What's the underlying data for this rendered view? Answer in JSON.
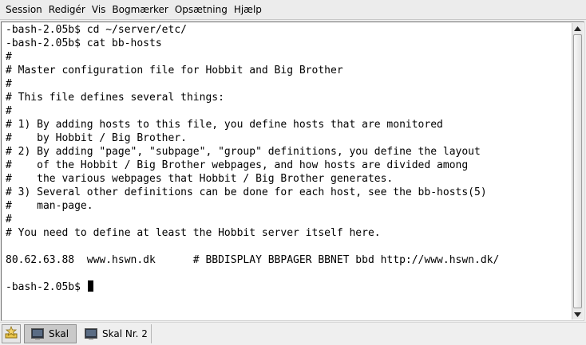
{
  "menubar": {
    "items": [
      "Session",
      "Redigér",
      "Vis",
      "Bogmærker",
      "Opsætning",
      "Hjælp"
    ]
  },
  "terminal": {
    "lines": [
      "-bash-2.05b$ cd ~/server/etc/",
      "-bash-2.05b$ cat bb-hosts",
      "#",
      "# Master configuration file for Hobbit and Big Brother",
      "#",
      "# This file defines several things:",
      "#",
      "# 1) By adding hosts to this file, you define hosts that are monitored",
      "#    by Hobbit / Big Brother.",
      "# 2) By adding \"page\", \"subpage\", \"group\" definitions, you define the layout",
      "#    of the Hobbit / Big Brother webpages, and how hosts are divided among",
      "#    the various webpages that Hobbit / Big Brother generates.",
      "# 3) Several other definitions can be done for each host, see the bb-hosts(5)",
      "#    man-page.",
      "#",
      "# You need to define at least the Hobbit server itself here.",
      "",
      "80.62.63.88  www.hswn.dk      # BBDISPLAY BBPAGER BBNET bbd http://www.hswn.dk/",
      "",
      "-bash-2.05b$ "
    ]
  },
  "tabs": {
    "items": [
      "Skal",
      "Skal Nr. 2"
    ]
  },
  "icons": {
    "new_tab": "new-session-icon",
    "terminal": "terminal-icon",
    "scroll_up": "arrow-up-icon",
    "scroll_down": "arrow-down-icon"
  }
}
